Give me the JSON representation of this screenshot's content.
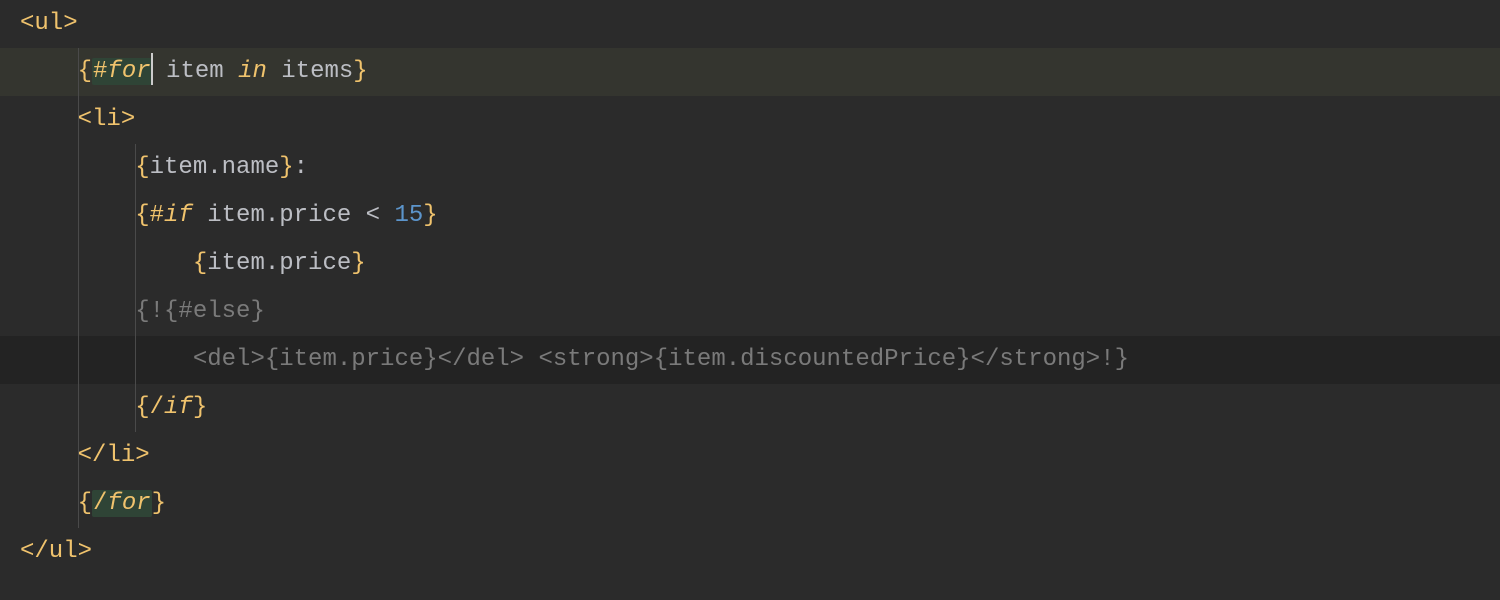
{
  "colors": {
    "bg": "#2b2b2b",
    "bg_hl": "#34352f",
    "bg_dark": "#232323",
    "tag": "#f0c36d",
    "default": "#bcbec4",
    "number": "#5c95cc",
    "comment": "#7a7a7a",
    "kw_bg": "#2f4436"
  },
  "lines": {
    "l1": {
      "ul_open": "<ul>"
    },
    "l2": {
      "brace_open": "{",
      "hash": "#",
      "for_kw": "for",
      "item": " item ",
      "in_kw": "in",
      "items": " items",
      "brace_close": "}"
    },
    "l3": {
      "li_open": "<li>"
    },
    "l4": {
      "brace_open": "{",
      "expr": "item.name",
      "brace_close": "}",
      "colon": ":"
    },
    "l5": {
      "brace_open": "{",
      "hash": "#",
      "if_kw": "if",
      "expr": " item.price ",
      "op": "<",
      "sp": " ",
      "num": "15",
      "brace_close": "}"
    },
    "l6": {
      "brace_open": "{",
      "expr": "item.price",
      "brace_close": "}"
    },
    "l7": {
      "text": "{!{#else}"
    },
    "l8": {
      "text": "<del>{item.price}</del> <strong>{item.discountedPrice}</strong>!}"
    },
    "l9": {
      "brace_open": "{",
      "slash": "/",
      "if_kw": "if",
      "brace_close": "}"
    },
    "l10": {
      "li_close": "</li>"
    },
    "l11": {
      "brace_open": "{",
      "slash": "/",
      "for_kw": "for",
      "brace_close": "}"
    },
    "l12": {
      "ul_close": "</ul>"
    }
  }
}
